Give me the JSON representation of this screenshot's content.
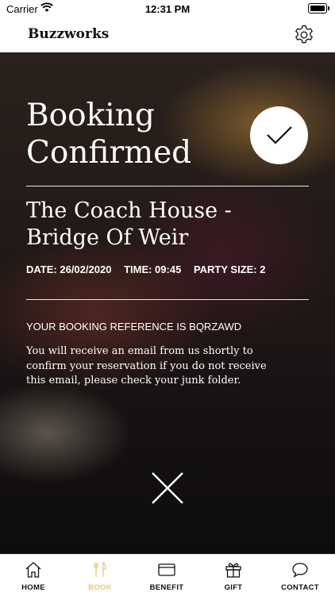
{
  "status_bar": {
    "carrier": "Carrier",
    "time": "12:31 PM"
  },
  "header": {
    "brand": "Buzzworks"
  },
  "booking": {
    "title": "Booking Confirmed",
    "venue": "The Coach House - Bridge Of Weir",
    "date": "DATE: 26/02/2020",
    "time": "TIME: 09:45",
    "party_size": "PARTY SIZE: 2",
    "reference": "YOUR BOOKING REFERENCE IS BQRZAWD",
    "message": "You will receive an email from us shortly to confirm your reservation if you do not receive this email, please check your junk folder."
  },
  "tabs": [
    {
      "label": "HOME",
      "icon": "house-icon",
      "active": false
    },
    {
      "label": "BOOK",
      "icon": "cutlery-icon",
      "active": true
    },
    {
      "label": "BENEFIT",
      "icon": "card-icon",
      "active": false
    },
    {
      "label": "GIFT",
      "icon": "gift-icon",
      "active": false
    },
    {
      "label": "CONTACT",
      "icon": "chat-bubble-icon",
      "active": false
    }
  ],
  "colors": {
    "active_tab": "#e8c878",
    "text_on_image": "#ffffff"
  }
}
